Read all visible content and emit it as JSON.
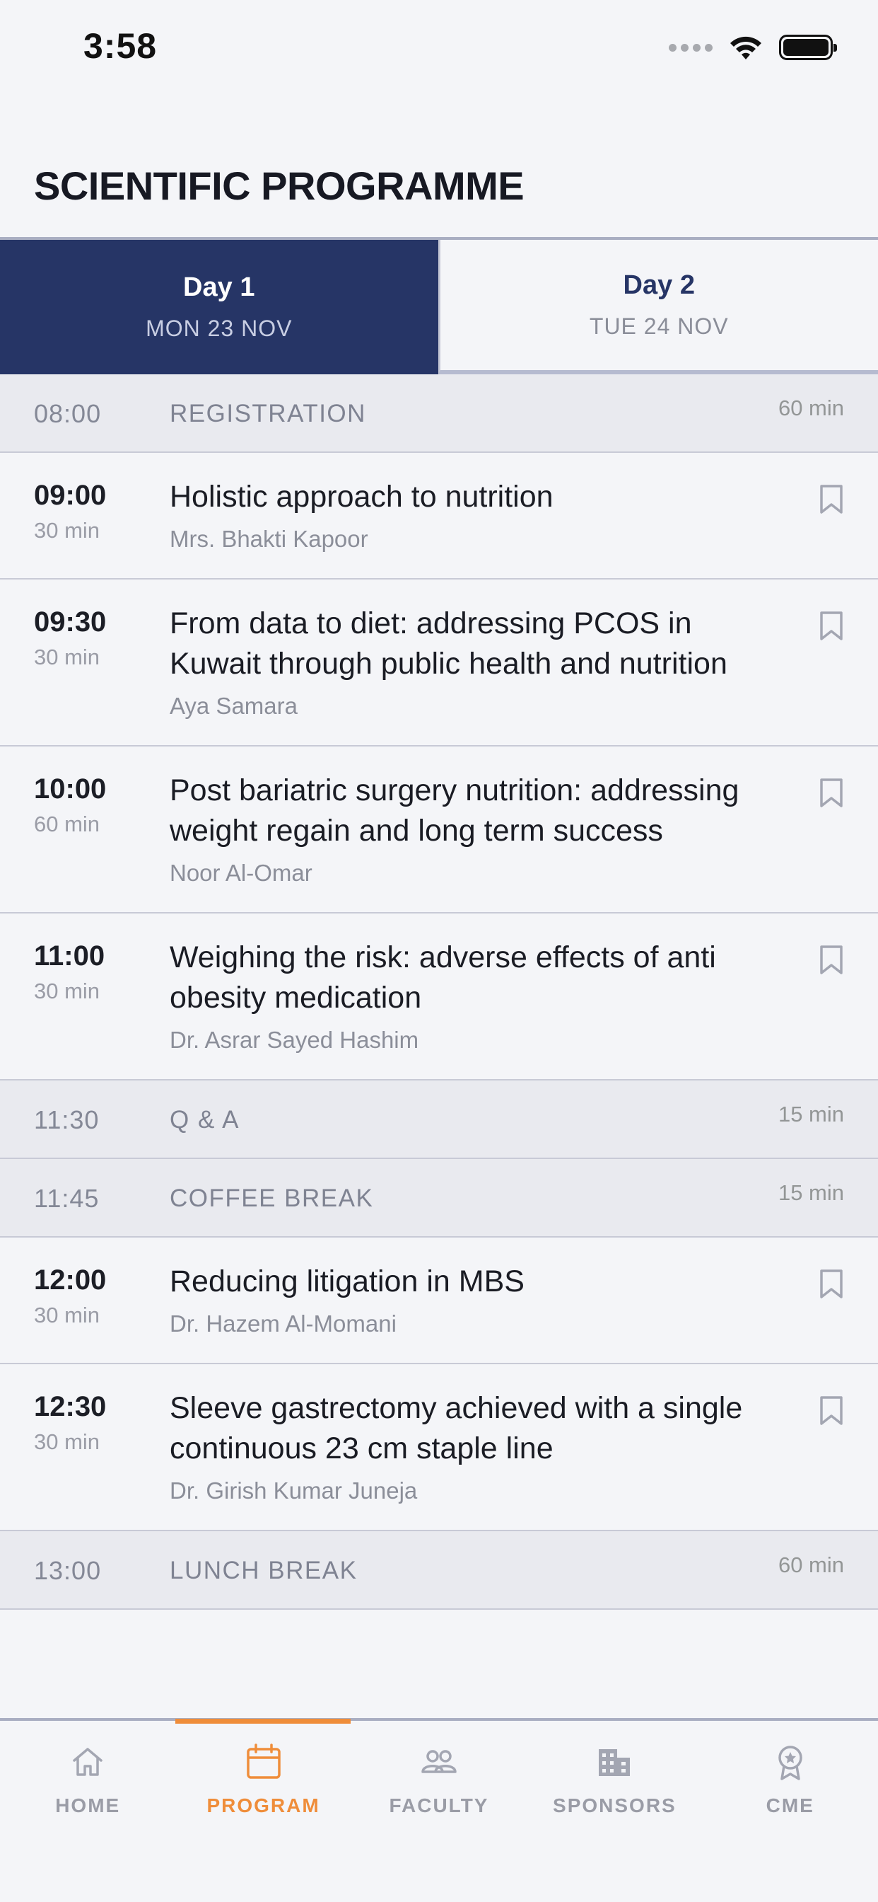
{
  "status_bar": {
    "time": "3:58"
  },
  "header": {
    "title": "SCIENTIFIC PROGRAMME"
  },
  "days": [
    {
      "name": "Day 1",
      "date": "MON 23 NOV",
      "active": true
    },
    {
      "name": "Day 2",
      "date": "TUE 24 NOV",
      "active": false
    }
  ],
  "schedule": [
    {
      "type": "break",
      "time": "08:00",
      "title": "REGISTRATION",
      "duration": "60 min"
    },
    {
      "type": "session",
      "time": "09:00",
      "duration": "30 min",
      "title": "Holistic approach to nutrition",
      "speaker": "Mrs. Bhakti Kapoor"
    },
    {
      "type": "session",
      "time": "09:30",
      "duration": "30 min",
      "title": "From data to diet: addressing PCOS in Kuwait through public health and nutrition",
      "speaker": "Aya Samara"
    },
    {
      "type": "session",
      "time": "10:00",
      "duration": "60 min",
      "title": "Post bariatric surgery nutrition: addressing weight regain and long term success",
      "speaker": "Noor Al-Omar"
    },
    {
      "type": "session",
      "time": "11:00",
      "duration": "30 min",
      "title": "Weighing the risk: adverse effects of anti obesity medication",
      "speaker": "Dr. Asrar Sayed Hashim"
    },
    {
      "type": "break",
      "time": "11:30",
      "title": "Q & A",
      "duration": "15 min"
    },
    {
      "type": "break",
      "time": "11:45",
      "title": "COFFEE BREAK",
      "duration": "15 min"
    },
    {
      "type": "session",
      "time": "12:00",
      "duration": "30 min",
      "title": "Reducing litigation in MBS",
      "speaker": "Dr. Hazem Al-Momani"
    },
    {
      "type": "session",
      "time": "12:30",
      "duration": "30 min",
      "title": "Sleeve gastrectomy achieved with a single continuous 23 cm staple line",
      "speaker": "Dr. Girish Kumar Juneja"
    },
    {
      "type": "break",
      "time": "13:00",
      "title": "LUNCH BREAK",
      "duration": "60 min"
    }
  ],
  "tabbar": {
    "items": [
      {
        "label": "HOME",
        "icon": "home-icon",
        "active": false
      },
      {
        "label": "PROGRAM",
        "icon": "calendar-icon",
        "active": true
      },
      {
        "label": "FACULTY",
        "icon": "people-icon",
        "active": false
      },
      {
        "label": "SPONSORS",
        "icon": "building-icon",
        "active": false
      },
      {
        "label": "CME",
        "icon": "award-icon",
        "active": false
      }
    ]
  },
  "colors": {
    "primary": "#263566",
    "accent": "#ef8d3a",
    "background": "#f4f5f8",
    "break_row": "#e9eaef"
  }
}
